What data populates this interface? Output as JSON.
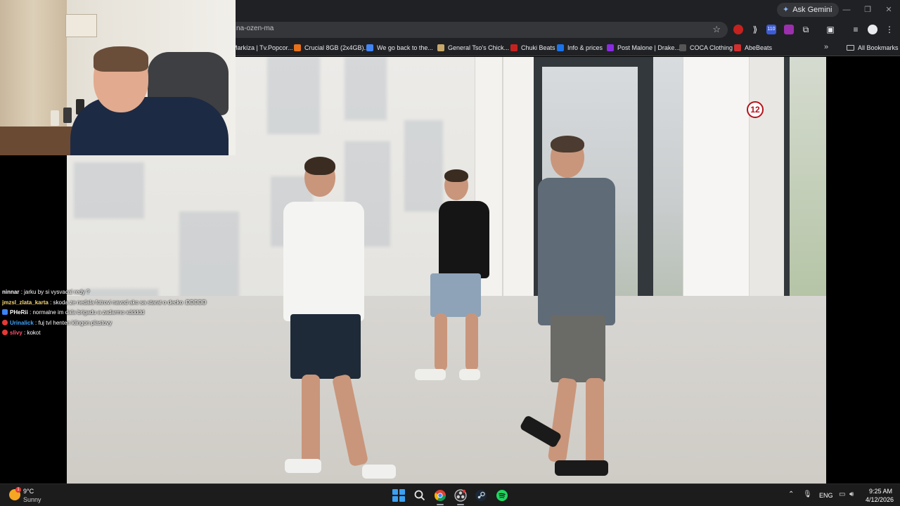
{
  "browser": {
    "url_fragment": "na-ozen-ma",
    "ask_gemini_label": "Ask Gemini",
    "extension_badge": "110",
    "bookmarks": [
      {
        "label": "Markíza | Tv.Popcor...",
        "color": "#4a4a4a"
      },
      {
        "label": "Crucial 8GB (2x4GB)...",
        "color": "#e8711a"
      },
      {
        "label": "We go back to the...",
        "color": "#4285f4"
      },
      {
        "label": "General Tso's Chick...",
        "color": "#c8a96a"
      },
      {
        "label": "Chuki Beats",
        "color": "#c5221f"
      },
      {
        "label": "Info & prices",
        "color": "#1a73e8"
      },
      {
        "label": "Post Malone | Drake...",
        "color": "#8a2be2"
      },
      {
        "label": "COCA Clothing",
        "color": "#555555"
      },
      {
        "label": "AbeBeats",
        "color": "#d32f2f"
      }
    ],
    "all_bookmarks_label": "All Bookmarks"
  },
  "video": {
    "age_rating": "12"
  },
  "chat": [
    {
      "user": "ninnar",
      "user_color": "#ffffff",
      "badge": "",
      "message": ": jarku by si vysvacal redy ?"
    },
    {
      "user": "jmzsl_zlata_karta",
      "user_color": "#f7d774",
      "badge": "",
      "message": ": skoda ze nedala fotrovi navod ako sa starat o decko :DDDDD"
    },
    {
      "user": "PHeRii",
      "user_color": "#ffffff",
      "badge": "#3b82f6",
      "message": ": normalne im dala brigadu a zadarmo xddddd"
    },
    {
      "user": "Urinalick",
      "user_color": "#3ea6ff",
      "badge": "#e53935",
      "message": ": fuj tvl henten klingon plastovy"
    },
    {
      "user": "slivy",
      "user_color": "#ff4f6d",
      "badge": "#e53935",
      "message": ": kokot"
    }
  ],
  "taskbar": {
    "weather_temp": "9°C",
    "weather_desc": "Sunny",
    "weather_badge": "1",
    "language": "ENG",
    "time": "9:25 AM",
    "date": "4/12/2026"
  }
}
